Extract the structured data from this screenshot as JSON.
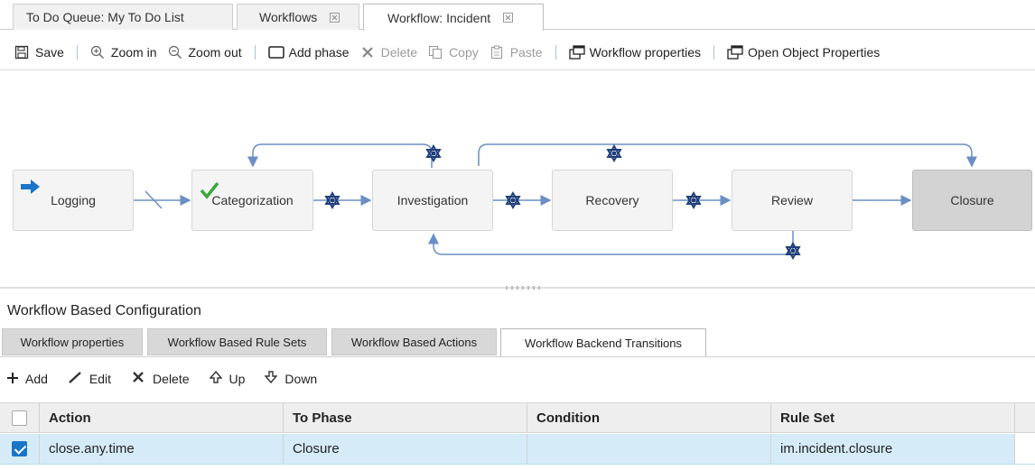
{
  "doc_tabs": [
    {
      "label": "To Do Queue: My To Do List",
      "closable": false
    },
    {
      "label": "Workflows",
      "closable": true
    },
    {
      "label": "Workflow: Incident",
      "closable": true,
      "active": true
    }
  ],
  "toolbar": {
    "save": "Save",
    "zoom_in": "Zoom in",
    "zoom_out": "Zoom out",
    "add_phase": "Add phase",
    "delete": "Delete",
    "copy": "Copy",
    "paste": "Paste",
    "workflow_properties": "Workflow properties",
    "open_object_properties": "Open Object Properties"
  },
  "phases": {
    "logging": "Logging",
    "categorization": "Categorization",
    "investigation": "Investigation",
    "recovery": "Recovery",
    "review": "Review",
    "closure": "Closure"
  },
  "config": {
    "title": "Workflow Based Configuration",
    "tabs": [
      "Workflow properties",
      "Workflow Based Rule Sets",
      "Workflow Based Actions",
      "Workflow Backend Transitions"
    ],
    "active_tab": "Workflow Backend Transitions"
  },
  "grid_toolbar": {
    "add": "Add",
    "edit": "Edit",
    "delete": "Delete",
    "up": "Up",
    "down": "Down"
  },
  "table": {
    "columns": [
      "Action",
      "To Phase",
      "Condition",
      "Rule Set"
    ],
    "rows": [
      {
        "selected": true,
        "action": "close.any.time",
        "to_phase": "Closure",
        "condition": "",
        "rule_set": "im.incident.closure"
      }
    ]
  },
  "colors": {
    "accent": "#1a74c8",
    "arrow": "#6a8fc4",
    "gear": "#1f3f7a",
    "check": "#3aa83a",
    "selected_row": "#d5ecf8"
  }
}
